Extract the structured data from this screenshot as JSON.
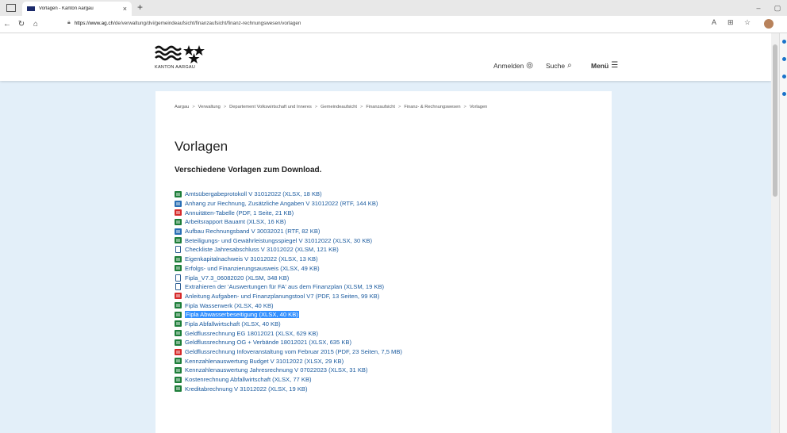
{
  "browser": {
    "tab_title": "Vorlagen - Kanton Aargau",
    "tab_close": "×",
    "new_tab": "+",
    "url_host": "https://www.ag.ch",
    "url_path": "/de/verwaltung/dvi/gemeindeaufsicht/finanzaufsicht/finanz-rechnungswesen/vorlagen",
    "min": "–",
    "max": "▢"
  },
  "site": {
    "logo_text": "KANTON AARGAU",
    "nav": {
      "login": "Anmelden",
      "search": "Suche",
      "menu": "Menü"
    }
  },
  "breadcrumb": [
    "Aargau",
    "Verwaltung",
    "Departement Volkswirtschaft und Inneres",
    "Gemeindeaufsicht",
    "Finanzaufsicht",
    "Finanz- & Rechnungswesen",
    "Vorlagen"
  ],
  "page": {
    "title": "Vorlagen",
    "lead": "Verschiedene Vorlagen zum Download."
  },
  "files": [
    {
      "type": "xlsx",
      "label": "Amtsübergabeprotokoll V 31012022 (XLSX, 18 KB)"
    },
    {
      "type": "rtf",
      "label": "Anhang zur Rechnung, Zusätzliche Angaben V 31012022 (RTF, 144 KB)"
    },
    {
      "type": "pdf",
      "label": "Annuitäten-Tabelle (PDF, 1 Seite, 21 KB)"
    },
    {
      "type": "xlsx",
      "label": "Arbeitsrapport Bauamt (XLSX, 16 KB)"
    },
    {
      "type": "rtf",
      "label": "Aufbau Rechnungsband V 30032021 (RTF, 82 KB)"
    },
    {
      "type": "xlsx",
      "label": "Beteiligungs- und Gewährleistungsspiegel V 31012022 (XLSX, 30 KB)"
    },
    {
      "type": "file",
      "label": "Checkliste Jahresabschluss V 31012022 (XLSM, 121 KB)"
    },
    {
      "type": "xlsx",
      "label": "Eigenkapitalnachweis V 31012022 (XLSX, 13 KB)"
    },
    {
      "type": "xlsx",
      "label": "Erfolgs- und Finanzierungsausweis (XLSX, 49 KB)"
    },
    {
      "type": "file",
      "label": "Fipla_V7.3_06082020 (XLSM, 348 KB)"
    },
    {
      "type": "file",
      "label": "Extrahieren der 'Auswertungen für FA' aus dem Finanzplan (XLSM, 19 KB)"
    },
    {
      "type": "pdf",
      "label": "Anleitung Aufgaben- und Finanzplanungstool V7 (PDF, 13 Seiten, 99 KB)"
    },
    {
      "type": "xlsx",
      "label": "Fipla Wasserwerk (XLSX, 40 KB)"
    },
    {
      "type": "xlsx",
      "label": "Fipla Abwasserbeseitigung (XLSX, 40 KB)",
      "selected": true
    },
    {
      "type": "xlsx",
      "label": "Fipla Abfallwirtschaft (XLSX, 40 KB)"
    },
    {
      "type": "xlsx",
      "label": "Geldflussrechnung EG 18012021 (XLSX, 629 KB)"
    },
    {
      "type": "xlsx",
      "label": "Geldflussrechnung OG + Verbände 18012021 (XLSX, 635 KB)"
    },
    {
      "type": "pdf",
      "label": "Geldflussrechnung Infoveranstaltung vom Februar 2015 (PDF, 23 Seiten, 7,5 MB)"
    },
    {
      "type": "xlsx",
      "label": "Kennzahlenauswertung Budget V 31012022 (XLSX, 29 KB)"
    },
    {
      "type": "xlsx",
      "label": "Kennzahlenauswertung Jahresrechnung V 07022023 (XLSX, 31 KB)"
    },
    {
      "type": "xlsx",
      "label": "Kostenrechnung Abfallwirtschaft (XLSX, 77 KB)"
    },
    {
      "type": "xlsx",
      "label": "Kreditabrechnung V 31012022 (XLSX, 19 KB)"
    }
  ],
  "colors": {
    "link": "#1a5a9e",
    "selection": "#3390ff",
    "page_bg": "#e3eff9"
  }
}
